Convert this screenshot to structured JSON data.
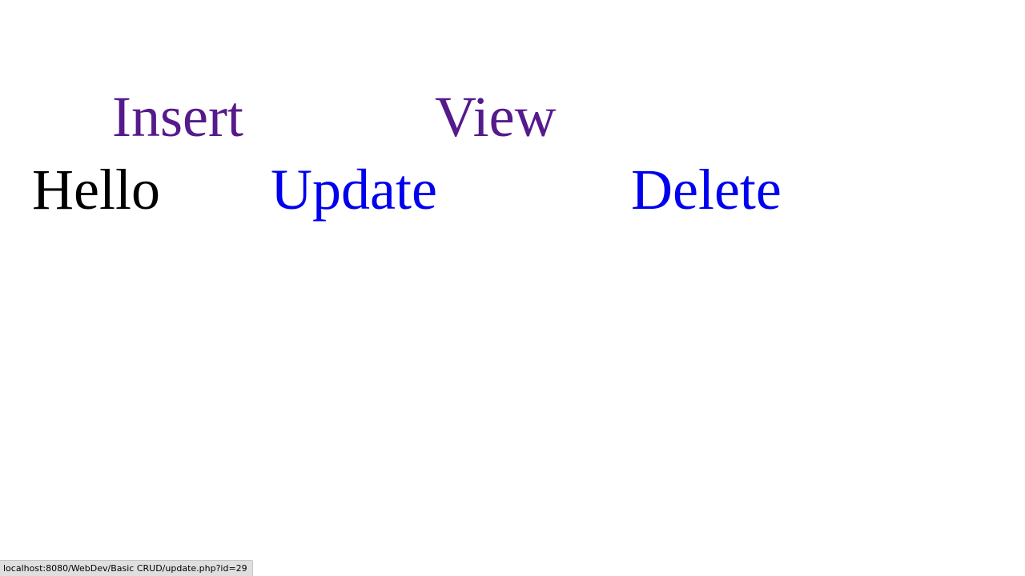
{
  "nav": {
    "insert_label": "Insert",
    "view_label": "View",
    "update_label": "Update",
    "delete_label": "Delete"
  },
  "record": {
    "name": "Hello"
  },
  "status_bar": {
    "url": "localhost:8080/WebDev/Basic CRUD/update.php?id=29"
  },
  "colors": {
    "visited_link": "#551a8b",
    "unvisited_link": "#0000ee",
    "text": "#000000",
    "background": "#ffffff",
    "status_bar_bg": "#dfdfdf"
  }
}
